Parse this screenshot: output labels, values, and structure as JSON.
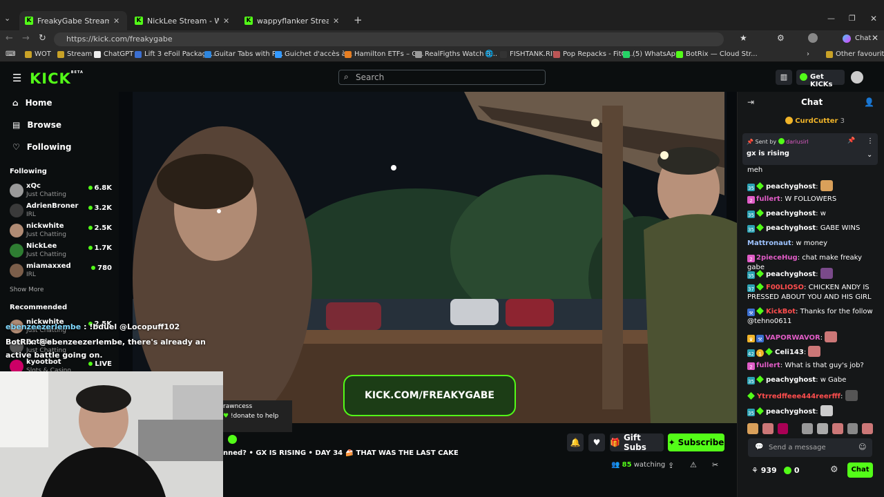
{
  "browser": {
    "tabs": [
      {
        "title": "FreakyGabe Stream - Watch L"
      },
      {
        "title": "NickLee Stream - Watch Live"
      },
      {
        "title": "wappyflanker Stream - Watch"
      }
    ],
    "url": "https://kick.com/freakygabe",
    "copilot_label": "Chat",
    "bookmarks": [
      "WOT",
      "Stream",
      "ChatGPT",
      "Lift 3 eFoil Package...",
      "Guitar Tabs with R...",
      "Guichet d'accès à...",
      "Hamilton ETFs – G...",
      "RealFigths Watch B...",
      "",
      "FISHTANK.RIP",
      "Pop Repacks - FitG...",
      "(5) WhatsApp",
      "BotRix — Cloud Str..."
    ],
    "other_favourites": "Other favourites"
  },
  "kick": {
    "logo": "KICK",
    "beta": "BETA",
    "search_placeholder": "Search",
    "get_kicks": "Get KICKs"
  },
  "sidebar": {
    "nav": [
      {
        "label": "Home"
      },
      {
        "label": "Browse"
      },
      {
        "label": "Following"
      }
    ],
    "following_title": "Following",
    "following": [
      {
        "name": "xQc",
        "category": "Just Chatting",
        "viewers": "6.8K"
      },
      {
        "name": "AdrienBroner",
        "category": "IRL",
        "viewers": "3.2K"
      },
      {
        "name": "nickwhite",
        "category": "Just Chatting",
        "viewers": "2.5K"
      },
      {
        "name": "NickLee",
        "category": "Just Chatting",
        "viewers": "1.7K"
      },
      {
        "name": "miamaxxed",
        "category": "IRL",
        "viewers": "780"
      }
    ],
    "show_more": "Show More",
    "recommended_title": "Recommended",
    "recommended": [
      {
        "name": "nickwhite",
        "category": "Just Chatting",
        "viewers": "2.5K"
      },
      {
        "name": "BotRix",
        "category": "Just Chatting",
        "viewers": ""
      },
      {
        "name": "kyootbot",
        "category": "Slots & Casino",
        "viewers": "LIVE"
      }
    ]
  },
  "overlay": {
    "line1_user": "ebenzeezerlembe",
    "line1_text": " : !bduel @Locopuff102",
    "line2_user": "BotRix",
    "line2_text": ": @ebenzeezerlembe, there's already an",
    "line3_text": "active battle going on.",
    "donate_user": "rawncess",
    "donate_text": "!donate to help",
    "banner": "KICK.COM/FREAKYGABE"
  },
  "stream": {
    "title": "nned? • GX IS RISING • DAY 34 🍰 THAT WAS THE LAST CAKE",
    "watching_count": "85",
    "watching_label": "watching",
    "gift_subs": "Gift Subs",
    "subscribe": "Subscribe"
  },
  "chat": {
    "title": "Chat",
    "top_gifter": "CurdCutter",
    "top_gifter_count": "3",
    "pinned_sent_by": "Sent by",
    "pinned_user": "dariusirl",
    "pinned_text": "gx is rising",
    "messages": [
      {
        "user": "",
        "text": "meh",
        "color": "#ffffff"
      },
      {
        "user": "peachyghost",
        "text": "",
        "color": "#ffffff"
      },
      {
        "user": "fullert",
        "text": " W FOLLOWERS",
        "color": "#e05cc6"
      },
      {
        "user": "peachyghost",
        "text": " w",
        "color": "#ffffff"
      },
      {
        "user": "peachyghost",
        "text": " GABE WINS",
        "color": "#ffffff"
      },
      {
        "user": "Mattronaut",
        "text": " w money",
        "color": "#9ec3ff"
      },
      {
        "user": "2pieceHug",
        "text": " chat make freaky gabe",
        "color": "#e05cc6"
      },
      {
        "user": "peachyghost",
        "text": "",
        "color": "#ffffff"
      },
      {
        "user": "F00LIOSO",
        "text": " CHICKEN ANDY IS PRESSED ABOUT YOU AND HIS GIRL",
        "color": "#ff4d4d"
      },
      {
        "user": "KickBot",
        "text": " Thanks for the follow @tehno0611",
        "color": "#ff4d4d"
      },
      {
        "user": "VAPORWAVOR",
        "text": "",
        "color": "#e05cc6"
      },
      {
        "user": "Celi143",
        "text": "",
        "color": "#ffffff"
      },
      {
        "user": "fullert",
        "text": " What is that guy's job?",
        "color": "#e05cc6"
      },
      {
        "user": "peachyghost",
        "text": " w Gabe",
        "color": "#ffffff"
      },
      {
        "user": "Ytrredffeee444reerfff",
        "text": "",
        "color": "#ff4d4d"
      },
      {
        "user": "peachyghost",
        "text": "",
        "color": "#ffffff"
      }
    ],
    "input_placeholder": "Send a message",
    "points": "939",
    "kicks": "0",
    "send": "Chat"
  }
}
